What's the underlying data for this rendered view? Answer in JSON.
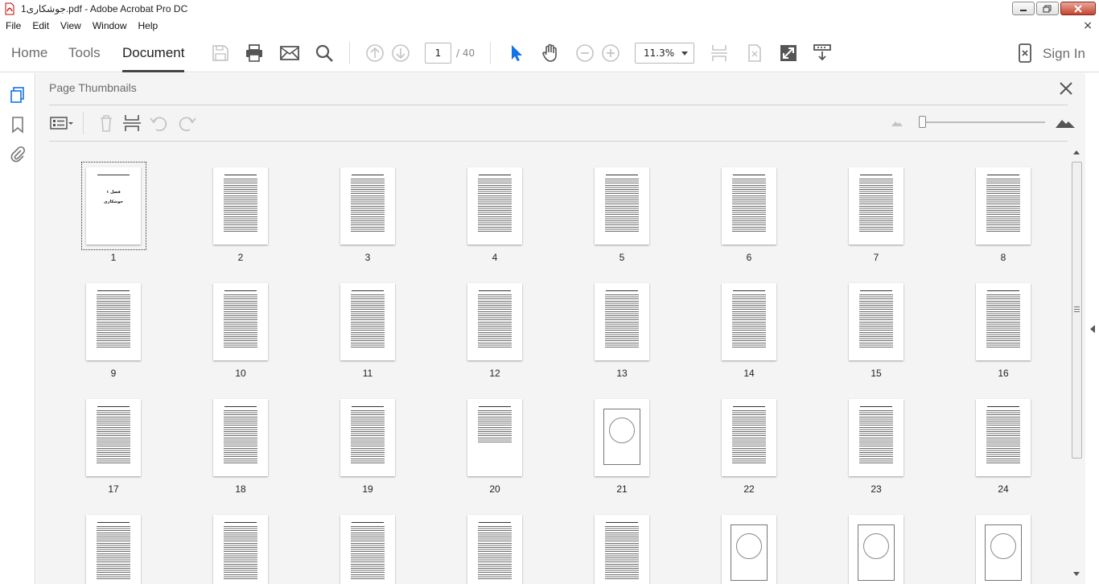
{
  "window": {
    "title": "1جوشکاری.pdf - Adobe Acrobat Pro DC",
    "min_label": "",
    "max_label": "",
    "close_label": ""
  },
  "menu": [
    "File",
    "Edit",
    "View",
    "Window",
    "Help"
  ],
  "toolbar": {
    "tabs": [
      {
        "label": "Home",
        "active": false
      },
      {
        "label": "Tools",
        "active": false
      },
      {
        "label": "Document",
        "active": true
      }
    ],
    "page_current": "1",
    "page_total": "/ 40",
    "zoom": "11.3%",
    "sign_in": "Sign In"
  },
  "panel": {
    "title": "Page Thumbnails"
  },
  "thumbnails": [
    {
      "label": "1",
      "kind": "cover",
      "selected": true,
      "cover_lines": [
        "فصل ۱",
        "جوشکاری"
      ]
    },
    {
      "label": "2",
      "kind": "text"
    },
    {
      "label": "3",
      "kind": "text"
    },
    {
      "label": "4",
      "kind": "text"
    },
    {
      "label": "5",
      "kind": "text"
    },
    {
      "label": "6",
      "kind": "text"
    },
    {
      "label": "7",
      "kind": "text"
    },
    {
      "label": "8",
      "kind": "text"
    },
    {
      "label": "9",
      "kind": "text"
    },
    {
      "label": "10",
      "kind": "text"
    },
    {
      "label": "11",
      "kind": "text"
    },
    {
      "label": "12",
      "kind": "text"
    },
    {
      "label": "13",
      "kind": "text"
    },
    {
      "label": "14",
      "kind": "text"
    },
    {
      "label": "15",
      "kind": "text"
    },
    {
      "label": "16",
      "kind": "text"
    },
    {
      "label": "17",
      "kind": "text"
    },
    {
      "label": "18",
      "kind": "text"
    },
    {
      "label": "19",
      "kind": "text"
    },
    {
      "label": "20",
      "kind": "short"
    },
    {
      "label": "21",
      "kind": "drawing"
    },
    {
      "label": "22",
      "kind": "text"
    },
    {
      "label": "23",
      "kind": "text"
    },
    {
      "label": "24",
      "kind": "text"
    },
    {
      "label": "",
      "kind": "text"
    },
    {
      "label": "",
      "kind": "text"
    },
    {
      "label": "",
      "kind": "text"
    },
    {
      "label": "",
      "kind": "text"
    },
    {
      "label": "",
      "kind": "text"
    },
    {
      "label": "",
      "kind": "drawing"
    },
    {
      "label": "",
      "kind": "drawing"
    },
    {
      "label": "",
      "kind": "drawing"
    }
  ],
  "colors": {
    "accent_blue": "#1473e6",
    "active_tab_underline": "#444444",
    "panel_bg": "#f4f4f4"
  }
}
